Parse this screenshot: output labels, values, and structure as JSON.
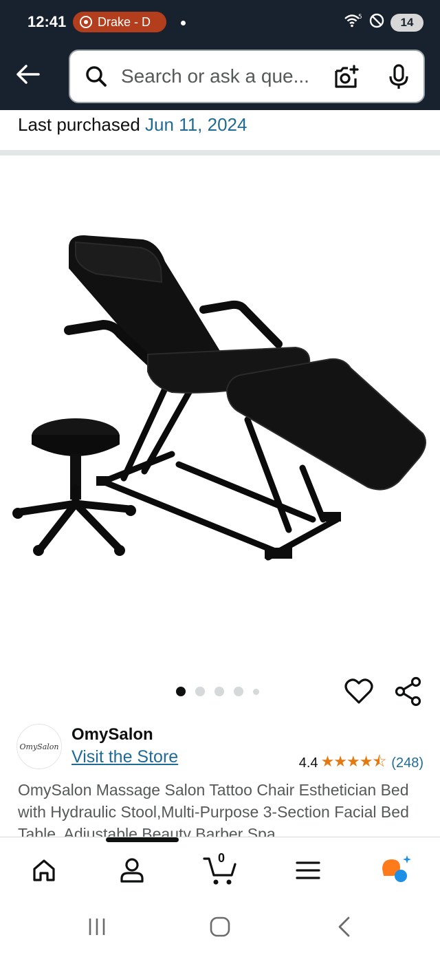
{
  "status_bar": {
    "time": "12:41",
    "media_label": "Drake - D",
    "wifi_label": "5",
    "battery": "14"
  },
  "search": {
    "placeholder": "Search or ask a que..."
  },
  "purchase": {
    "label": "Last purchased",
    "date": "Jun 11, 2024"
  },
  "gallery": {
    "image_count": 5,
    "active_index": 0
  },
  "store": {
    "logo_text": "OmySalon",
    "name": "OmySalon",
    "link": "Visit the Store"
  },
  "rating": {
    "value": "4.4",
    "stars": "★★★★⯪",
    "count": "(248)"
  },
  "product": {
    "title": "OmySalon Massage Salon Tattoo Chair Esthetician Bed with Hydraulic Stool,Multi-Purpose 3-Section Facial Bed Table, Adjustable Beauty Barber Spa"
  },
  "bottom_nav": {
    "cart_count": "0"
  },
  "colors": {
    "header_bg": "#18222e",
    "link": "#1f6b96",
    "star": "#e47911",
    "media_pill": "#b33e1d",
    "rufus_orange": "#ff7a1a",
    "rufus_blue": "#1d8fe6"
  }
}
